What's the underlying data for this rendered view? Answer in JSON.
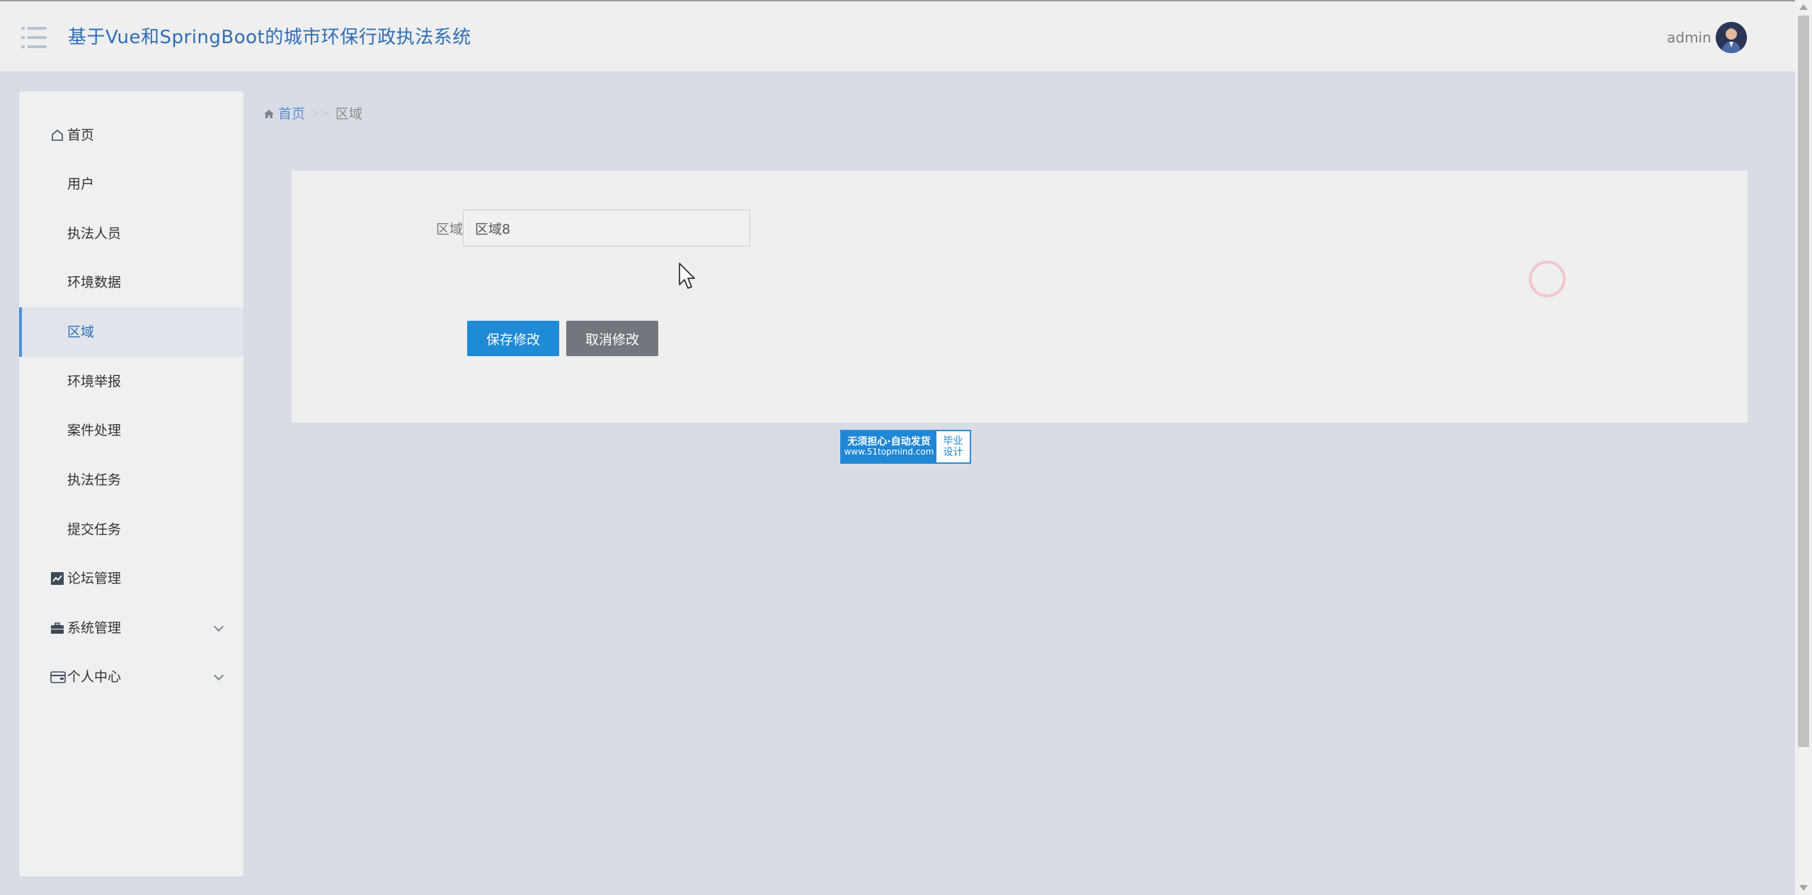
{
  "header": {
    "title": "基于Vue和SpringBoot的城市环保行政执法系统",
    "username": "admin"
  },
  "sidebar": {
    "items": [
      {
        "label": "首页",
        "icon": "home-icon"
      },
      {
        "label": "用户",
        "icon": "grid-icon"
      },
      {
        "label": "执法人员",
        "icon": "grid-icon"
      },
      {
        "label": "环境数据",
        "icon": "grid-icon"
      },
      {
        "label": "区域",
        "icon": "grid-icon",
        "active": true
      },
      {
        "label": "环境举报",
        "icon": "grid-icon"
      },
      {
        "label": "案件处理",
        "icon": "grid-icon"
      },
      {
        "label": "执法任务",
        "icon": "grid-icon"
      },
      {
        "label": "提交任务",
        "icon": "grid-icon"
      },
      {
        "label": "论坛管理",
        "icon": "chart-icon"
      },
      {
        "label": "系统管理",
        "icon": "briefcase-icon",
        "expandable": true
      },
      {
        "label": "个人中心",
        "icon": "wallet-icon",
        "expandable": true
      }
    ]
  },
  "breadcrumb": {
    "home": "首页",
    "separator": ">>",
    "current": "区域"
  },
  "form": {
    "field_label": "区域",
    "field_value": "区域8",
    "save_label": "保存修改",
    "cancel_label": "取消修改"
  },
  "badge": {
    "line1": "无须担心·自动发货",
    "line2": "www.51topmind.com",
    "right1": "毕业",
    "right2": "设计"
  },
  "colors": {
    "accent": "#1f8ad6",
    "title": "#2e6eb6",
    "cancel": "#72777d",
    "background": "#d8dce5"
  }
}
